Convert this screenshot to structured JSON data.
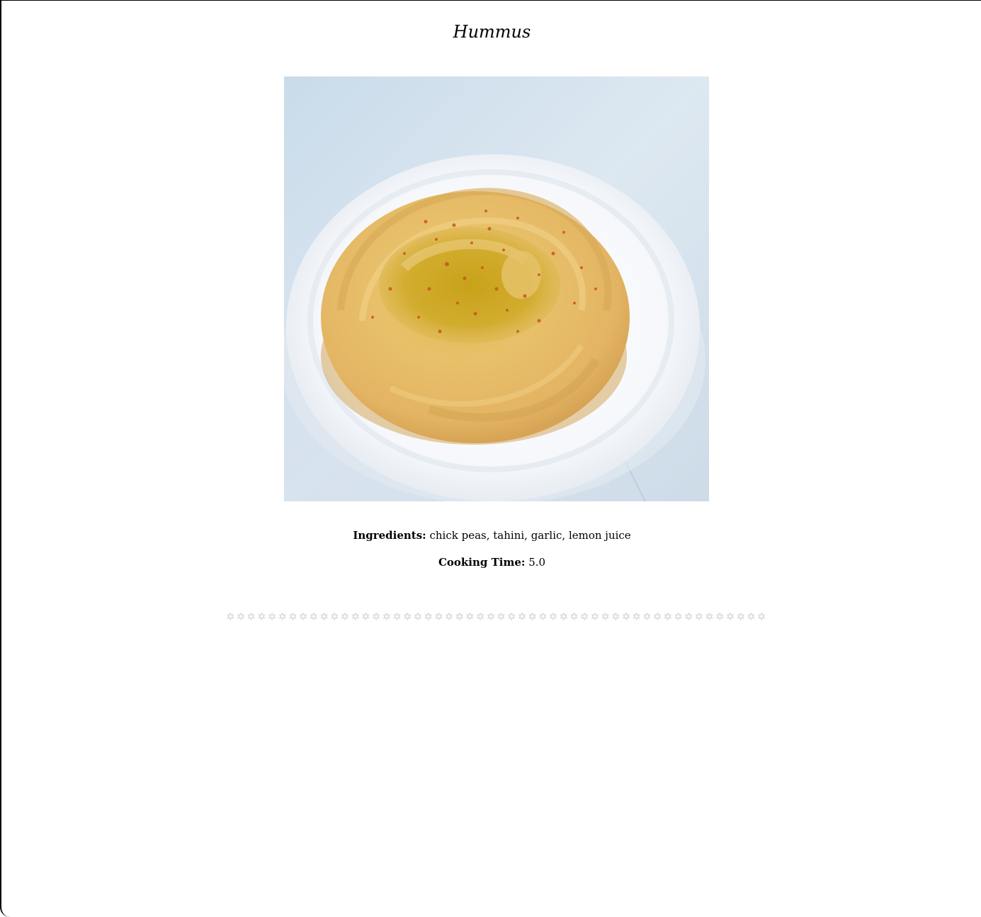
{
  "recipe": {
    "title": "Hummus",
    "ingredients_label": "Ingredients:",
    "ingredients_value": "chick peas, tahini, garlic, lemon juice",
    "cooking_time_label": "Cooking Time:",
    "cooking_time_value": "5.0"
  },
  "rating": {
    "star_glyph": "✡",
    "star_count": 52,
    "filled": 0,
    "star_color": "#cfcfcf"
  },
  "colors": {
    "background": "#ffffff",
    "text": "#000000"
  }
}
